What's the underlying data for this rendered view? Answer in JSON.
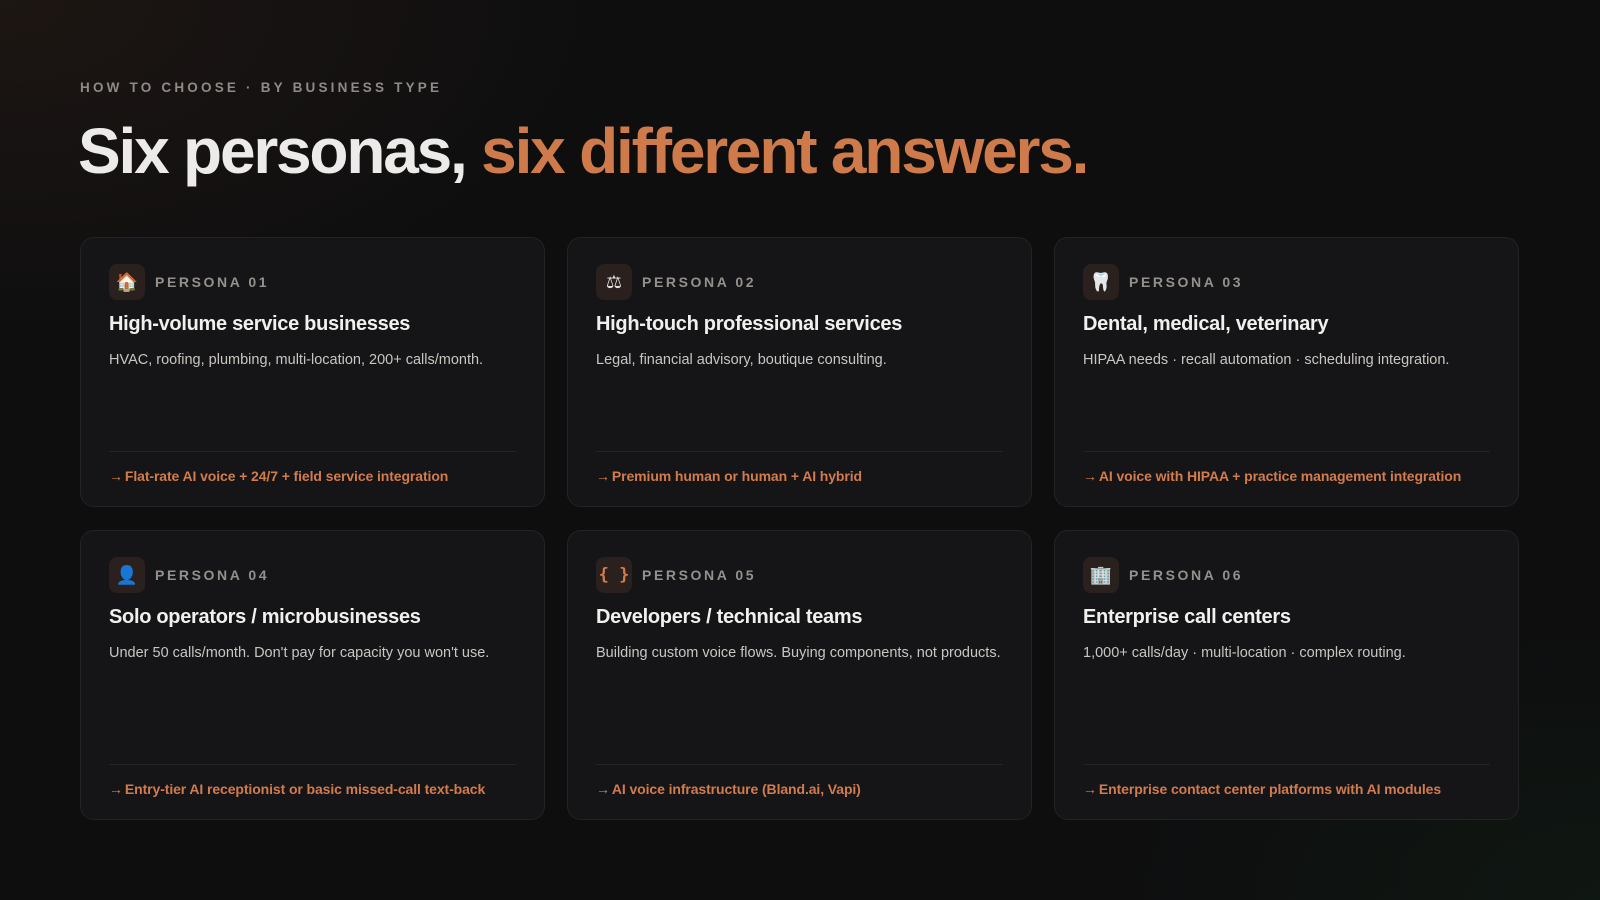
{
  "eyebrow": "HOW TO CHOOSE · BY BUSINESS TYPE",
  "headline": {
    "part1": "Six personas, ",
    "part2": "six different answers."
  },
  "colors": {
    "accent": "#cf7a4b",
    "card_bg": "#151517",
    "page_bg": "#0e0e0f"
  },
  "personas": [
    {
      "icon": "🏠",
      "icon_name": "house-icon",
      "label": "PERSONA 01",
      "title": "High-volume service businesses",
      "desc": "HVAC, roofing, plumbing, multi-location, 200+ calls/month.",
      "arrow": "→",
      "rec": "Flat-rate AI voice + 24/7 + field service integration"
    },
    {
      "icon": "⚖",
      "icon_name": "scales-icon",
      "label": "PERSONA 02",
      "title": "High-touch professional services",
      "desc": "Legal, financial advisory, boutique consulting.",
      "arrow": "→",
      "rec": "Premium human or human + AI hybrid"
    },
    {
      "icon": "🦷",
      "icon_name": "tooth-icon",
      "label": "PERSONA 03",
      "title": "Dental, medical, veterinary",
      "desc": "HIPAA needs · recall automation · scheduling integration.",
      "arrow": "→",
      "rec": "AI voice with HIPAA + practice management integration"
    },
    {
      "icon": "👤",
      "icon_name": "person-icon",
      "label": "PERSONA 04",
      "title": "Solo operators / microbusinesses",
      "desc": "Under 50 calls/month. Don't pay for capacity you won't use.",
      "arrow": "→",
      "rec": "Entry-tier AI receptionist or basic missed-call text-back"
    },
    {
      "icon": "{ }",
      "icon_name": "code-braces-icon",
      "label": "PERSONA 05",
      "title": "Developers / technical teams",
      "desc": "Building custom voice flows. Buying components, not products.",
      "arrow": "→",
      "rec": "AI voice infrastructure (Bland.ai, Vapi)"
    },
    {
      "icon": "🏢",
      "icon_name": "office-building-icon",
      "label": "PERSONA 06",
      "title": "Enterprise call centers",
      "desc": "1,000+ calls/day · multi-location · complex routing.",
      "arrow": "→",
      "rec": "Enterprise contact center platforms with AI modules"
    }
  ]
}
